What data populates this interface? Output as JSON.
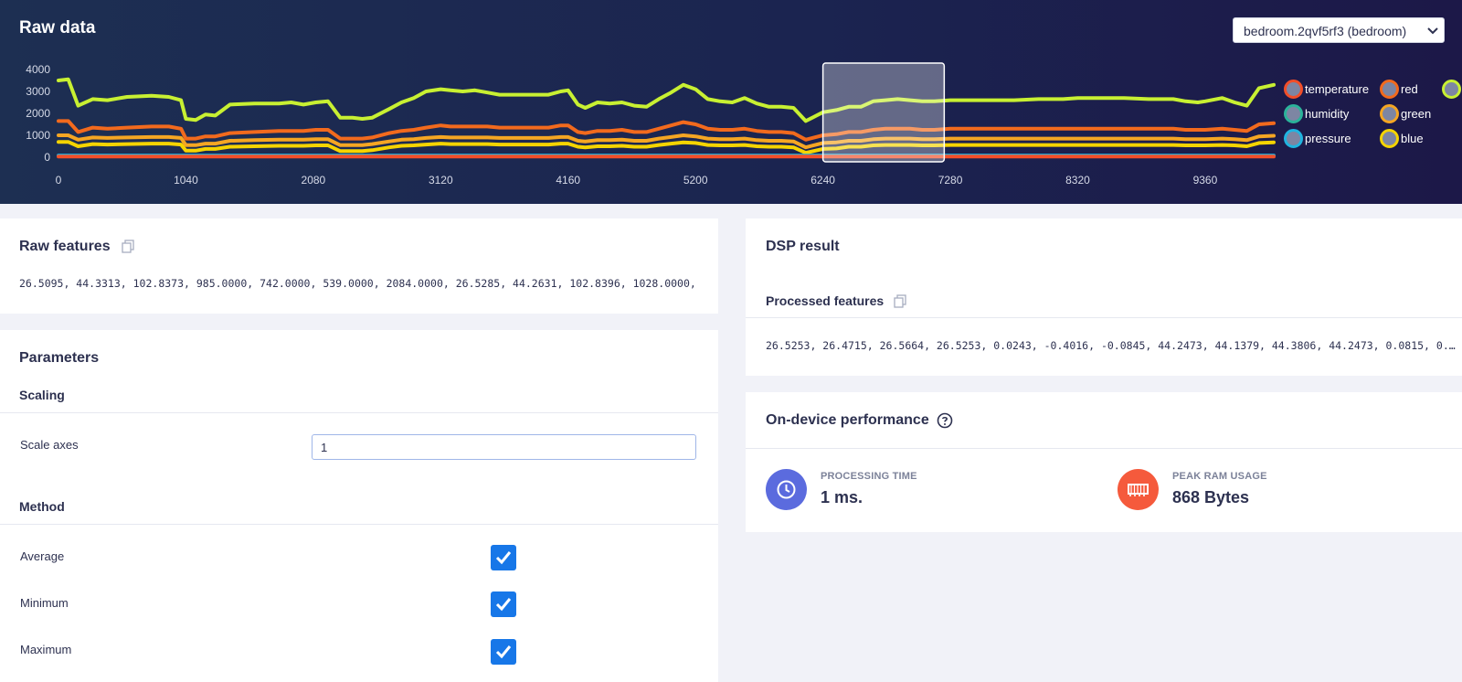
{
  "raw_data": {
    "title": "Raw data",
    "device_select": {
      "value": "bedroom.2qvf5rf3 (bedroom)"
    }
  },
  "legend": [
    {
      "label": "temperature",
      "color": "#f24e29"
    },
    {
      "label": "humidity",
      "color": "#2bb39a"
    },
    {
      "label": "pressure",
      "color": "#20b4e0"
    },
    {
      "label": "red",
      "color": "#f26a1d"
    },
    {
      "label": "green",
      "color": "#f5a623"
    },
    {
      "label": "blue",
      "color": "#f5d400"
    },
    {
      "label": "",
      "color": "#c8f032"
    }
  ],
  "chart_data": {
    "type": "line",
    "y_ticks": [
      "4000",
      "3000",
      "2000",
      "1000",
      "0"
    ],
    "x_ticks": [
      "0",
      "1040",
      "2080",
      "3120",
      "4160",
      "5200",
      "6240",
      "7280",
      "8320",
      "9360"
    ],
    "xlim": [
      0,
      9920
    ],
    "ylim": [
      0,
      4000
    ],
    "window": [
      6240,
      7230
    ],
    "x": [
      0,
      80,
      160,
      280,
      400,
      560,
      760,
      900,
      1000,
      1040,
      1120,
      1200,
      1280,
      1400,
      1600,
      1800,
      1900,
      2000,
      2100,
      2200,
      2300,
      2400,
      2480,
      2560,
      2700,
      2800,
      2900,
      3000,
      3120,
      3200,
      3300,
      3400,
      3500,
      3600,
      3700,
      3800,
      3900,
      4000,
      4100,
      4160,
      4240,
      4300,
      4400,
      4500,
      4600,
      4700,
      4800,
      4900,
      5000,
      5100,
      5200,
      5300,
      5400,
      5500,
      5600,
      5700,
      5800,
      5900,
      6000,
      6100,
      6240,
      6350,
      6450,
      6550,
      6650,
      6750,
      6850,
      6950,
      7050,
      7150,
      7280,
      7400,
      7600,
      7800,
      8000,
      8200,
      8320,
      8500,
      8700,
      8900,
      9100,
      9200,
      9300,
      9360,
      9500,
      9600,
      9700,
      9800,
      9920
    ],
    "series": [
      {
        "name": "",
        "color": "#c8f032",
        "values": [
          3500,
          3550,
          2350,
          2650,
          2600,
          2750,
          2800,
          2750,
          2600,
          1750,
          1700,
          1950,
          1900,
          2400,
          2450,
          2450,
          2500,
          2400,
          2500,
          2550,
          1800,
          1800,
          1750,
          1800,
          2200,
          2500,
          2700,
          3000,
          3100,
          3050,
          3000,
          3050,
          2950,
          2850,
          2850,
          2850,
          2850,
          2850,
          3000,
          3050,
          2400,
          2250,
          2500,
          2450,
          2500,
          2350,
          2300,
          2650,
          2950,
          3300,
          3100,
          2650,
          2550,
          2500,
          2700,
          2450,
          2300,
          2300,
          2250,
          1650,
          2050,
          2150,
          2300,
          2300,
          2550,
          2600,
          2650,
          2600,
          2550,
          2550,
          2600,
          2600,
          2600,
          2600,
          2650,
          2650,
          2700,
          2700,
          2700,
          2650,
          2650,
          2550,
          2500,
          2550,
          2700,
          2500,
          2350,
          3150,
          3300
        ]
      },
      {
        "name": "",
        "color": "#f26a1d",
        "values": [
          1650,
          1650,
          1150,
          1350,
          1300,
          1350,
          1400,
          1400,
          1300,
          850,
          850,
          950,
          950,
          1100,
          1150,
          1200,
          1200,
          1200,
          1250,
          1250,
          850,
          850,
          850,
          900,
          1100,
          1200,
          1250,
          1350,
          1450,
          1400,
          1400,
          1400,
          1400,
          1350,
          1350,
          1350,
          1350,
          1350,
          1450,
          1450,
          1150,
          1100,
          1200,
          1200,
          1250,
          1150,
          1150,
          1300,
          1450,
          1600,
          1500,
          1300,
          1250,
          1250,
          1300,
          1200,
          1150,
          1150,
          1100,
          800,
          1000,
          1050,
          1150,
          1150,
          1250,
          1300,
          1300,
          1300,
          1250,
          1250,
          1300,
          1300,
          1300,
          1300,
          1300,
          1300,
          1300,
          1300,
          1300,
          1300,
          1300,
          1250,
          1250,
          1250,
          1300,
          1250,
          1200,
          1500,
          1550
        ]
      },
      {
        "name": "",
        "color": "#f5a623",
        "values": [
          1000,
          1000,
          800,
          900,
          880,
          900,
          920,
          920,
          880,
          550,
          550,
          620,
          620,
          750,
          780,
          800,
          800,
          800,
          820,
          820,
          550,
          550,
          550,
          600,
          720,
          800,
          820,
          880,
          920,
          900,
          900,
          900,
          900,
          880,
          880,
          880,
          880,
          880,
          920,
          920,
          750,
          720,
          780,
          780,
          800,
          750,
          750,
          850,
          920,
          1000,
          950,
          850,
          820,
          820,
          850,
          780,
          750,
          750,
          720,
          450,
          650,
          680,
          750,
          750,
          820,
          850,
          850,
          850,
          820,
          820,
          850,
          850,
          850,
          850,
          850,
          850,
          850,
          850,
          850,
          850,
          850,
          820,
          820,
          820,
          850,
          820,
          780,
          950,
          980
        ]
      },
      {
        "name": "",
        "color": "#f5d400",
        "values": [
          700,
          700,
          500,
          600,
          580,
          600,
          620,
          620,
          580,
          300,
          300,
          380,
          380,
          480,
          500,
          520,
          520,
          520,
          540,
          540,
          280,
          280,
          280,
          320,
          450,
          520,
          540,
          580,
          620,
          600,
          600,
          600,
          600,
          580,
          580,
          580,
          580,
          580,
          620,
          620,
          480,
          450,
          500,
          500,
          520,
          480,
          480,
          560,
          620,
          680,
          650,
          560,
          540,
          540,
          560,
          500,
          480,
          480,
          450,
          200,
          380,
          400,
          480,
          480,
          540,
          560,
          560,
          560,
          540,
          540,
          560,
          560,
          560,
          560,
          560,
          560,
          560,
          560,
          560,
          560,
          560,
          540,
          540,
          540,
          560,
          540,
          500,
          650,
          680
        ]
      },
      {
        "name": "",
        "color": "#20b4e0",
        "values": [
          80,
          80,
          80,
          80,
          80,
          80,
          80,
          80,
          80,
          80,
          80,
          80,
          80,
          80,
          80,
          80,
          80,
          80,
          80,
          80,
          80,
          80,
          80,
          80,
          80,
          80,
          80,
          80,
          80,
          80,
          80,
          80,
          80,
          80,
          80,
          80,
          80,
          80,
          80,
          80,
          80,
          80,
          80,
          80,
          80,
          80,
          80,
          80,
          80,
          80,
          80,
          80,
          80,
          80,
          80,
          80,
          80,
          80,
          80,
          80,
          80,
          80,
          80,
          80,
          80,
          80,
          80,
          80,
          80,
          80,
          80,
          80,
          80,
          80,
          80,
          80,
          80,
          80,
          80,
          80,
          80,
          80,
          80,
          80,
          80,
          80,
          80,
          80,
          80
        ]
      },
      {
        "name": "",
        "color": "#f24e29",
        "values": [
          30,
          30,
          30,
          30,
          30,
          30,
          30,
          30,
          30,
          30,
          30,
          30,
          30,
          30,
          30,
          30,
          30,
          30,
          30,
          30,
          30,
          30,
          30,
          30,
          30,
          30,
          30,
          30,
          30,
          30,
          30,
          30,
          30,
          30,
          30,
          30,
          30,
          30,
          30,
          30,
          30,
          30,
          30,
          30,
          30,
          30,
          30,
          30,
          30,
          30,
          30,
          30,
          30,
          30,
          30,
          30,
          30,
          30,
          30,
          30,
          30,
          30,
          30,
          30,
          30,
          30,
          30,
          30,
          30,
          30,
          30,
          30,
          30,
          30,
          30,
          30,
          30,
          30,
          30,
          30,
          30,
          30,
          30,
          30,
          30,
          30,
          30,
          30,
          30
        ]
      }
    ]
  },
  "raw_features": {
    "title": "Raw features",
    "values": "26.5095, 44.3313, 102.8373, 985.0000, 742.0000, 539.0000, 2084.0000, 26.5285, 44.2631, 102.8396, 1028.0000, …"
  },
  "parameters": {
    "title": "Parameters",
    "scaling": {
      "title": "Scaling",
      "scale_axes_label": "Scale axes",
      "scale_axes_value": "1"
    },
    "method": {
      "title": "Method",
      "options": [
        {
          "label": "Average",
          "checked": true
        },
        {
          "label": "Minimum",
          "checked": true
        },
        {
          "label": "Maximum",
          "checked": true
        }
      ]
    }
  },
  "dsp_result": {
    "title": "DSP result",
    "processed_title": "Processed features",
    "processed_values": "26.5253, 26.4715, 26.5664, 26.5253, 0.0243, -0.4016, -0.0845, 44.2473, 44.1379, 44.3806, 44.2473, 0.0815, 0.…"
  },
  "performance": {
    "title": "On-device performance",
    "processing_time": {
      "label": "PROCESSING TIME",
      "value": "1 ms.",
      "color": "#5b6bde"
    },
    "peak_ram": {
      "label": "PEAK RAM USAGE",
      "value": "868 Bytes",
      "color": "#f55a3c"
    }
  }
}
